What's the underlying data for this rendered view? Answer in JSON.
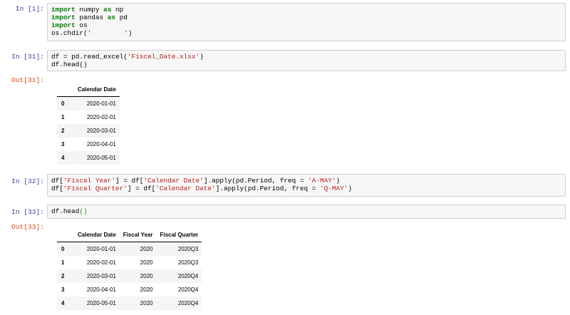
{
  "cells": {
    "c1": {
      "prompt": "In [1]:",
      "l1": {
        "k1": "import",
        "t1": " numpy ",
        "k2": "as",
        "t2": " np"
      },
      "l2": {
        "k1": "import",
        "t1": " pandas ",
        "k2": "as",
        "t2": " pd"
      },
      "l3": {
        "k1": "import",
        "t1": " os"
      },
      "l4": {
        "t1": "os.chdir(",
        "s1": "'",
        "s2": "'",
        "t2": ")"
      }
    },
    "c31": {
      "prompt": "In [31]:",
      "l1": {
        "t1": "df = pd.read_excel(",
        "s1": "'Fiscal_Date.xlsx'",
        "t2": ")"
      },
      "l2": {
        "t1": "df.head()"
      },
      "out_prompt": "Out[31]:",
      "table": {
        "headers": [
          "",
          "Calendar Date"
        ],
        "rows": [
          [
            "0",
            "2020-01-01"
          ],
          [
            "1",
            "2020-02-01"
          ],
          [
            "2",
            "2020-03-01"
          ],
          [
            "3",
            "2020-04-01"
          ],
          [
            "4",
            "2020-05-01"
          ]
        ]
      }
    },
    "c32": {
      "prompt": "In [32]:",
      "l1": {
        "t1": "df[",
        "s1": "'Fiscal Year'",
        "t2": "] = df[",
        "s2": "'Calendar Date'",
        "t3": "].apply(pd.Period, freq = ",
        "s3": "'A-MAY'",
        "t4": ")"
      },
      "l2": {
        "t1": "df[",
        "s1": "'Fiscal Quarter'",
        "t2": "] = df[",
        "s2": "'Calendar Date'",
        "t3": "].apply(pd.Period, freq = ",
        "s3": "'Q-MAY'",
        "t4": ")"
      }
    },
    "c33": {
      "prompt": "In [33]:",
      "l1": {
        "t1": "df.head",
        "p1": "()"
      },
      "out_prompt": "Out[33]:",
      "table": {
        "headers": [
          "",
          "Calendar Date",
          "Fiscal Year",
          "Fiscal Quarter"
        ],
        "rows": [
          [
            "0",
            "2020-01-01",
            "2020",
            "2020Q3"
          ],
          [
            "1",
            "2020-02-01",
            "2020",
            "2020Q3"
          ],
          [
            "2",
            "2020-03-01",
            "2020",
            "2020Q4"
          ],
          [
            "3",
            "2020-04-01",
            "2020",
            "2020Q4"
          ],
          [
            "4",
            "2020-05-01",
            "2020",
            "2020Q4"
          ]
        ]
      }
    }
  }
}
